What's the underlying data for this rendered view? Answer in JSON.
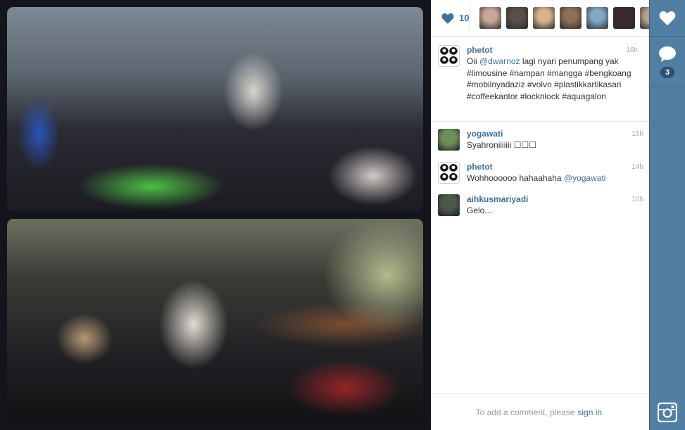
{
  "likes": {
    "count": "10",
    "likers": [
      {
        "name": "liker-1",
        "color": "#c9a79a"
      },
      {
        "name": "liker-2",
        "color": "#5a4f4b"
      },
      {
        "name": "liker-3",
        "color": "#d9b38a"
      },
      {
        "name": "liker-4",
        "color": "#8d6f57"
      },
      {
        "name": "liker-5",
        "color": "#7fa8c9"
      },
      {
        "name": "liker-6",
        "color": "#3a2c2c"
      },
      {
        "name": "liker-7",
        "color": "#b4a58a"
      }
    ]
  },
  "caption": {
    "username": "phetot",
    "time": "16h",
    "text_before": "Oii ",
    "mention": "@dwarnoz",
    "text_after": " lagi nyari penumpang yak #limousine #nampan #mangga #bengkoang #mobilnyadaziz #volvo #plastikkartikasari #coffeekantor #locknlock #aquagalon"
  },
  "comments": [
    {
      "username": "yogawati",
      "time": "15h",
      "text": "Syahroniiiiiii ☐☐☐",
      "mention": "",
      "avatar": "#6e8f5a"
    },
    {
      "username": "phetot",
      "time": "14h",
      "text": "Wohhoooooo hahaahaha ",
      "mention": "@yogawati",
      "avatar": "phetot"
    },
    {
      "username": "aihkusmariyadi",
      "time": "10h",
      "text": "Gelo...",
      "mention": "",
      "avatar": "#4a5a4a"
    }
  ],
  "add_comment": {
    "prompt": "To add a comment, please",
    "link": "sign in",
    "period": "."
  },
  "sidebar": {
    "comment_count": "3"
  },
  "colors": {
    "accent": "#3f729b",
    "sidebar": "#517fa4"
  },
  "icons": [
    "heart-icon",
    "comment-icon",
    "instagram-icon"
  ]
}
